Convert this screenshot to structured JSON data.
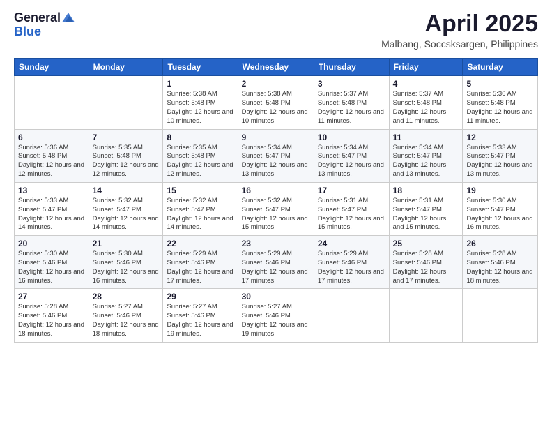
{
  "header": {
    "logo": {
      "general": "General",
      "blue": "Blue",
      "icon_title": "GeneralBlue logo"
    },
    "title": "April 2025",
    "location": "Malbang, Soccsksargen, Philippines"
  },
  "calendar": {
    "days_of_week": [
      "Sunday",
      "Monday",
      "Tuesday",
      "Wednesday",
      "Thursday",
      "Friday",
      "Saturday"
    ],
    "weeks": [
      [
        {
          "day": "",
          "info": ""
        },
        {
          "day": "",
          "info": ""
        },
        {
          "day": "1",
          "info": "Sunrise: 5:38 AM\nSunset: 5:48 PM\nDaylight: 12 hours and 10 minutes."
        },
        {
          "day": "2",
          "info": "Sunrise: 5:38 AM\nSunset: 5:48 PM\nDaylight: 12 hours and 10 minutes."
        },
        {
          "day": "3",
          "info": "Sunrise: 5:37 AM\nSunset: 5:48 PM\nDaylight: 12 hours and 11 minutes."
        },
        {
          "day": "4",
          "info": "Sunrise: 5:37 AM\nSunset: 5:48 PM\nDaylight: 12 hours and 11 minutes."
        },
        {
          "day": "5",
          "info": "Sunrise: 5:36 AM\nSunset: 5:48 PM\nDaylight: 12 hours and 11 minutes."
        }
      ],
      [
        {
          "day": "6",
          "info": "Sunrise: 5:36 AM\nSunset: 5:48 PM\nDaylight: 12 hours and 12 minutes."
        },
        {
          "day": "7",
          "info": "Sunrise: 5:35 AM\nSunset: 5:48 PM\nDaylight: 12 hours and 12 minutes."
        },
        {
          "day": "8",
          "info": "Sunrise: 5:35 AM\nSunset: 5:48 PM\nDaylight: 12 hours and 12 minutes."
        },
        {
          "day": "9",
          "info": "Sunrise: 5:34 AM\nSunset: 5:47 PM\nDaylight: 12 hours and 13 minutes."
        },
        {
          "day": "10",
          "info": "Sunrise: 5:34 AM\nSunset: 5:47 PM\nDaylight: 12 hours and 13 minutes."
        },
        {
          "day": "11",
          "info": "Sunrise: 5:34 AM\nSunset: 5:47 PM\nDaylight: 12 hours and 13 minutes."
        },
        {
          "day": "12",
          "info": "Sunrise: 5:33 AM\nSunset: 5:47 PM\nDaylight: 12 hours and 13 minutes."
        }
      ],
      [
        {
          "day": "13",
          "info": "Sunrise: 5:33 AM\nSunset: 5:47 PM\nDaylight: 12 hours and 14 minutes."
        },
        {
          "day": "14",
          "info": "Sunrise: 5:32 AM\nSunset: 5:47 PM\nDaylight: 12 hours and 14 minutes."
        },
        {
          "day": "15",
          "info": "Sunrise: 5:32 AM\nSunset: 5:47 PM\nDaylight: 12 hours and 14 minutes."
        },
        {
          "day": "16",
          "info": "Sunrise: 5:32 AM\nSunset: 5:47 PM\nDaylight: 12 hours and 15 minutes."
        },
        {
          "day": "17",
          "info": "Sunrise: 5:31 AM\nSunset: 5:47 PM\nDaylight: 12 hours and 15 minutes."
        },
        {
          "day": "18",
          "info": "Sunrise: 5:31 AM\nSunset: 5:47 PM\nDaylight: 12 hours and 15 minutes."
        },
        {
          "day": "19",
          "info": "Sunrise: 5:30 AM\nSunset: 5:47 PM\nDaylight: 12 hours and 16 minutes."
        }
      ],
      [
        {
          "day": "20",
          "info": "Sunrise: 5:30 AM\nSunset: 5:46 PM\nDaylight: 12 hours and 16 minutes."
        },
        {
          "day": "21",
          "info": "Sunrise: 5:30 AM\nSunset: 5:46 PM\nDaylight: 12 hours and 16 minutes."
        },
        {
          "day": "22",
          "info": "Sunrise: 5:29 AM\nSunset: 5:46 PM\nDaylight: 12 hours and 17 minutes."
        },
        {
          "day": "23",
          "info": "Sunrise: 5:29 AM\nSunset: 5:46 PM\nDaylight: 12 hours and 17 minutes."
        },
        {
          "day": "24",
          "info": "Sunrise: 5:29 AM\nSunset: 5:46 PM\nDaylight: 12 hours and 17 minutes."
        },
        {
          "day": "25",
          "info": "Sunrise: 5:28 AM\nSunset: 5:46 PM\nDaylight: 12 hours and 17 minutes."
        },
        {
          "day": "26",
          "info": "Sunrise: 5:28 AM\nSunset: 5:46 PM\nDaylight: 12 hours and 18 minutes."
        }
      ],
      [
        {
          "day": "27",
          "info": "Sunrise: 5:28 AM\nSunset: 5:46 PM\nDaylight: 12 hours and 18 minutes."
        },
        {
          "day": "28",
          "info": "Sunrise: 5:27 AM\nSunset: 5:46 PM\nDaylight: 12 hours and 18 minutes."
        },
        {
          "day": "29",
          "info": "Sunrise: 5:27 AM\nSunset: 5:46 PM\nDaylight: 12 hours and 19 minutes."
        },
        {
          "day": "30",
          "info": "Sunrise: 5:27 AM\nSunset: 5:46 PM\nDaylight: 12 hours and 19 minutes."
        },
        {
          "day": "",
          "info": ""
        },
        {
          "day": "",
          "info": ""
        },
        {
          "day": "",
          "info": ""
        }
      ]
    ]
  }
}
